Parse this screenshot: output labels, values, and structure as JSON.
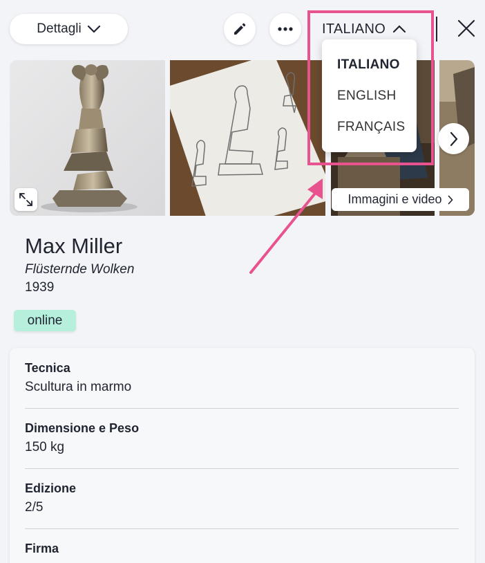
{
  "header": {
    "details_label": "Dettagli",
    "language_label": "ITALIANO"
  },
  "language_menu": {
    "items": [
      {
        "label": "ITALIANO",
        "active": true
      },
      {
        "label": "ENGLISH",
        "active": false
      },
      {
        "label": "FRANÇAIS",
        "active": false
      }
    ]
  },
  "gallery": {
    "media_label": "Immagini e video"
  },
  "artwork": {
    "artist": "Max Miller",
    "title": "Flüsternde Wolken",
    "year": "1939",
    "status": "online"
  },
  "details": [
    {
      "label": "Tecnica",
      "value": "Scultura in marmo"
    },
    {
      "label": "Dimensione e Peso",
      "value": "150 kg"
    },
    {
      "label": "Edizione",
      "value": "2/5"
    },
    {
      "label": "Firma",
      "value": ""
    }
  ],
  "colors": {
    "highlight": "#e8528f",
    "badge_bg": "#b6f0dc"
  }
}
